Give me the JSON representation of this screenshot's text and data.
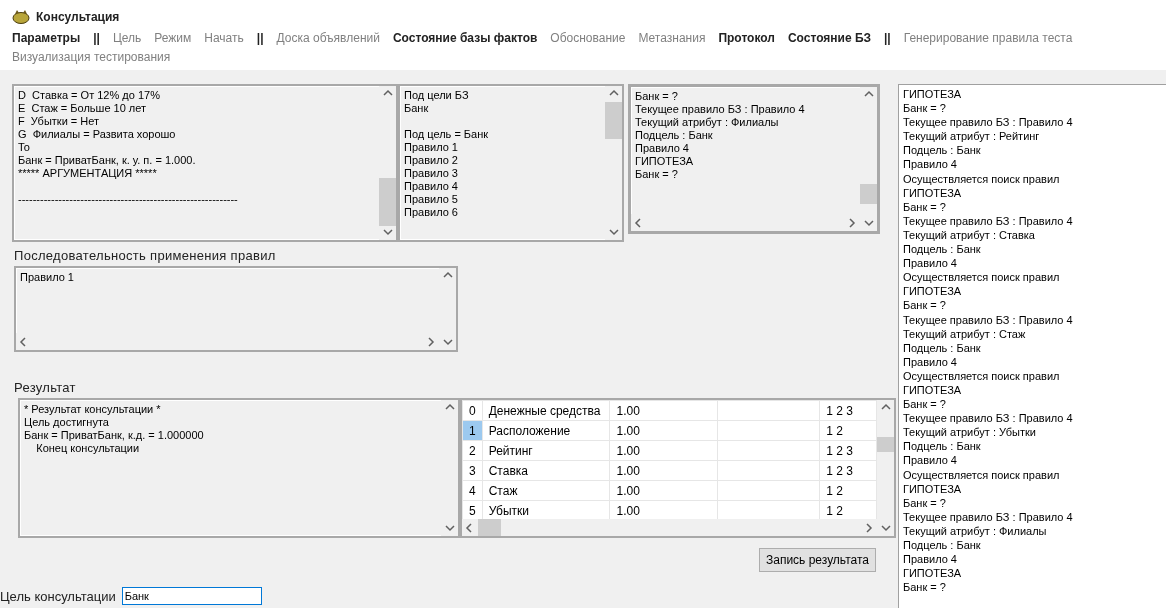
{
  "window": {
    "title": "Консультация"
  },
  "menu": {
    "rows": [
      [
        {
          "kind": "item",
          "label": "Параметры",
          "enabled": true
        },
        {
          "kind": "separator",
          "label": "||"
        },
        {
          "kind": "item",
          "label": "Цель",
          "enabled": false
        },
        {
          "kind": "item",
          "label": "Режим",
          "enabled": false
        },
        {
          "kind": "item",
          "label": "Начать",
          "enabled": false
        },
        {
          "kind": "separator",
          "label": "||"
        },
        {
          "kind": "item",
          "label": "Доска объявлений",
          "enabled": false
        },
        {
          "kind": "item",
          "label": "Состояние базы фактов",
          "enabled": true
        },
        {
          "kind": "item",
          "label": "Обоснование",
          "enabled": false
        },
        {
          "kind": "item",
          "label": "Метазнания",
          "enabled": false
        },
        {
          "kind": "item",
          "label": "Протокол",
          "enabled": true
        },
        {
          "kind": "item",
          "label": "Состояние БЗ",
          "enabled": true
        },
        {
          "kind": "separator",
          "label": "||"
        },
        {
          "kind": "item",
          "label": "Генерирование правила теста",
          "enabled": false
        }
      ],
      [
        {
          "kind": "item",
          "label": "Визуализация тестирования",
          "enabled": false
        }
      ]
    ]
  },
  "explanation": {
    "lines": [
      "D  Ставка = От 12% до 17%",
      "E  Стаж = Больше 10 лет",
      "F  Убытки = Нет",
      "G  Филиалы = Развита хорошо",
      "То",
      "Банк = ПриватБанк, к. у. п. = 1.000.",
      "***** АРГУМЕНТАЦИЯ *****"
    ],
    "footer": "------------------------------------------------------------"
  },
  "goals": {
    "header": [
      "Под цели БЗ",
      "Банк"
    ],
    "lines": [
      "Под цель = Банк",
      "Правило 1",
      "Правило 2",
      "Правило 3",
      "Правило 4",
      "Правило 5",
      "Правило 6"
    ]
  },
  "current": {
    "lines": [
      "Банк = ?",
      "Текущее правило БЗ : Правило 4",
      "Текущий атрибут : Филиалы",
      "Подцель : Банк",
      "Правило 4",
      "ГИПОТЕЗА",
      "Банк = ?"
    ]
  },
  "sequence": {
    "label": "Последовательность применения правил",
    "lines": [
      "Правило 1"
    ]
  },
  "result": {
    "label": "Результат",
    "lines": [
      "* Результат консультации *",
      "Цель достигнута",
      "Банк = ПриватБанк, к.д. = 1.000000",
      "    Конец консультации"
    ]
  },
  "table": {
    "rows": [
      {
        "index": "0",
        "name": "Денежные средства",
        "value": "1.00",
        "tail": "1 2 3",
        "selected": false
      },
      {
        "index": "1",
        "name": "Расположение",
        "value": "1.00",
        "tail": "1 2",
        "selected": true
      },
      {
        "index": "2",
        "name": "Рейтинг",
        "value": "1.00",
        "tail": "1 2 3",
        "selected": false
      },
      {
        "index": "3",
        "name": "Ставка",
        "value": "1.00",
        "tail": "1 2 3",
        "selected": false
      },
      {
        "index": "4",
        "name": "Стаж",
        "value": "1.00",
        "tail": "1 2",
        "selected": false
      },
      {
        "index": "5",
        "name": "Убытки",
        "value": "1.00",
        "tail": "1 2",
        "selected": false
      }
    ]
  },
  "save_button": "Запись результата",
  "goal_field": {
    "label": "Цель консультации",
    "value": "Банк"
  },
  "log": {
    "lines": [
      "ГИПОТЕЗА",
      "Банк = ?",
      "Текущее правило БЗ : Правило 4",
      "Текущий атрибут : Рейтинг",
      "Подцель : Банк",
      "Правило 4",
      "Осуществляется поиск правил",
      "ГИПОТЕЗА",
      "Банк = ?",
      "Текущее правило БЗ : Правило 4",
      "Текущий атрибут : Ставка",
      "Подцель : Банк",
      "Правило 4",
      "Осуществляется поиск правил",
      "ГИПОТЕЗА",
      "Банк = ?",
      "Текущее правило БЗ : Правило 4",
      "Текущий атрибут : Стаж",
      "Подцель : Банк",
      "Правило 4",
      "Осуществляется поиск правил",
      "ГИПОТЕЗА",
      "Банк = ?",
      "Текущее правило БЗ : Правило 4",
      "Текущий атрибут : Убытки",
      "Подцель : Банк",
      "Правило 4",
      "Осуществляется поиск правил",
      "ГИПОТЕЗА",
      "Банк = ?",
      "Текущее правило БЗ : Правило 4",
      "Текущий атрибут : Филиалы",
      "Подцель : Банк",
      "Правило 4",
      "ГИПОТЕЗА",
      "Банк = ?"
    ]
  }
}
